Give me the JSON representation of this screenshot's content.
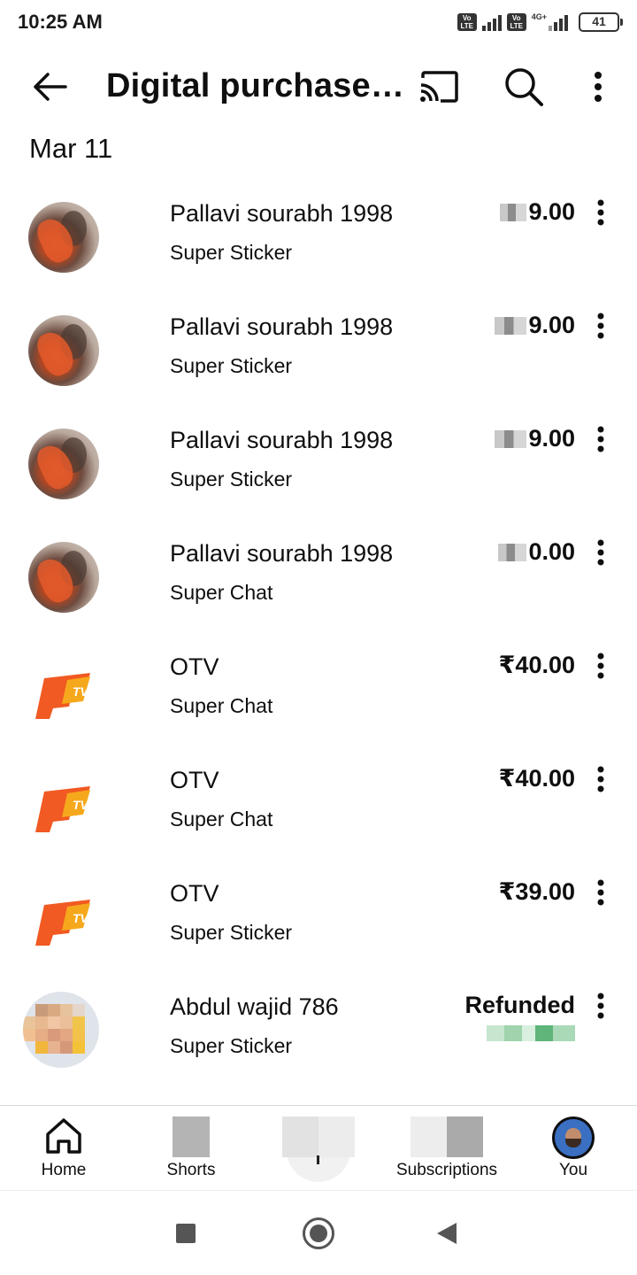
{
  "status_bar": {
    "time": "10:25 AM",
    "volte_label": "Vo LTE",
    "network_type": "4G+",
    "battery": "41"
  },
  "app_bar": {
    "title": "Digital purchase…",
    "icons": [
      "back-arrow-icon",
      "cast-icon",
      "search-icon",
      "more-vert-icon"
    ]
  },
  "date_header": "Mar 11",
  "purchases": [
    {
      "channel": "Pallavi sourabh 1998",
      "type": "Super Sticker",
      "amount": "9.00",
      "amount_partially_hidden": true,
      "avatar": "pallavi"
    },
    {
      "channel": "Pallavi sourabh 1998",
      "type": "Super Sticker",
      "amount": "9.00",
      "amount_partially_hidden": true,
      "avatar": "pallavi"
    },
    {
      "channel": "Pallavi sourabh 1998",
      "type": "Super Sticker",
      "amount": "9.00",
      "amount_partially_hidden": true,
      "avatar": "pallavi"
    },
    {
      "channel": "Pallavi sourabh 1998",
      "type": "Super Chat",
      "amount": "0.00",
      "amount_partially_hidden": true,
      "avatar": "pallavi"
    },
    {
      "channel": "OTV",
      "type": "Super Chat",
      "amount": "₹40.00",
      "amount_partially_hidden": false,
      "avatar": "otv"
    },
    {
      "channel": "OTV",
      "type": "Super Chat",
      "amount": "₹40.00",
      "amount_partially_hidden": false,
      "avatar": "otv"
    },
    {
      "channel": "OTV",
      "type": "Super Sticker",
      "amount": "₹39.00",
      "amount_partially_hidden": false,
      "avatar": "otv"
    },
    {
      "channel": "Abdul wajid 786",
      "type": "Super Sticker",
      "amount": "Refunded",
      "amount_partially_hidden": false,
      "avatar": "abdul"
    }
  ],
  "bottom_nav": {
    "home": "Home",
    "shorts": "Shorts",
    "subscriptions": "Subscriptions",
    "you": "You"
  },
  "colors": {
    "otv_orange": "#f15a22",
    "otv_yellow": "#f6a81c",
    "text": "#0f0f0f",
    "divider": "#d9d9d9"
  }
}
